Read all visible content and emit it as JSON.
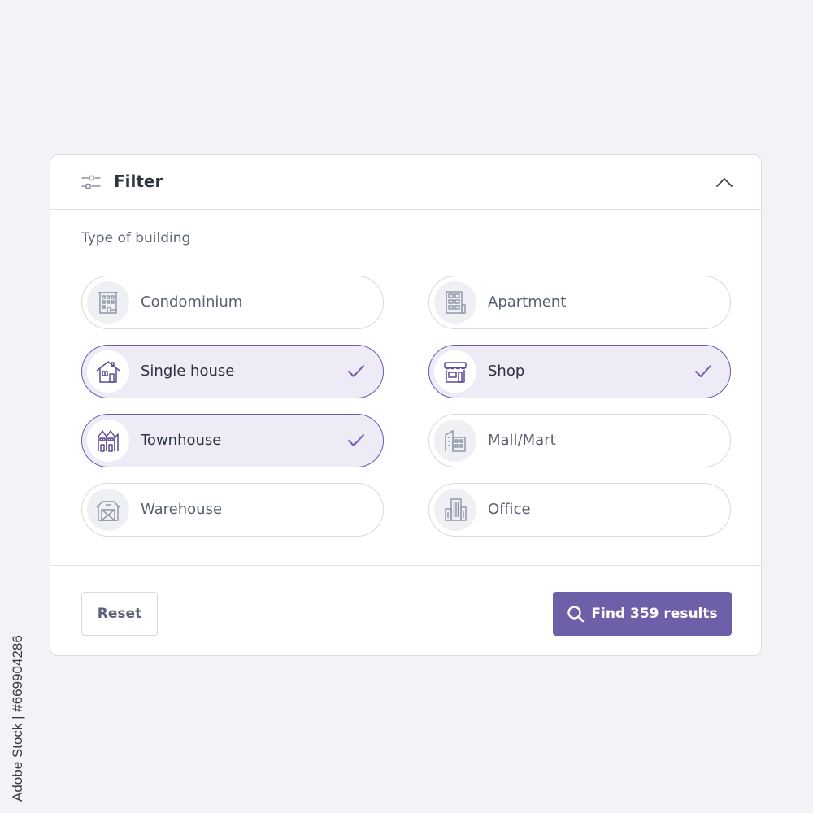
{
  "header": {
    "title": "Filter",
    "filter_icon": "sliders-icon",
    "collapse_icon": "chevron-up-icon"
  },
  "section": {
    "label": "Type of building"
  },
  "options": [
    {
      "label": "Condominium",
      "icon": "condominium-icon",
      "checked": false
    },
    {
      "label": "Apartment",
      "icon": "apartment-icon",
      "checked": false
    },
    {
      "label": "Single house",
      "icon": "house-icon",
      "checked": true
    },
    {
      "label": "Shop",
      "icon": "shop-icon",
      "checked": true
    },
    {
      "label": "Townhouse",
      "icon": "townhouse-icon",
      "checked": true
    },
    {
      "label": "Mall/Mart",
      "icon": "mall-icon",
      "checked": false
    },
    {
      "label": "Warehouse",
      "icon": "warehouse-icon",
      "checked": false
    },
    {
      "label": "Office",
      "icon": "office-icon",
      "checked": false
    }
  ],
  "footer": {
    "reset_label": "Reset",
    "find_label": "Find 359 results",
    "find_icon": "search-icon"
  },
  "watermark_id": "669904286",
  "stock_label": "Adobe Stock | #669904286",
  "colors": {
    "accent": "#6d5fa8",
    "checked_bg": "#eeebf7",
    "border": "#d6d9e0",
    "background": "#f1f3f7"
  }
}
